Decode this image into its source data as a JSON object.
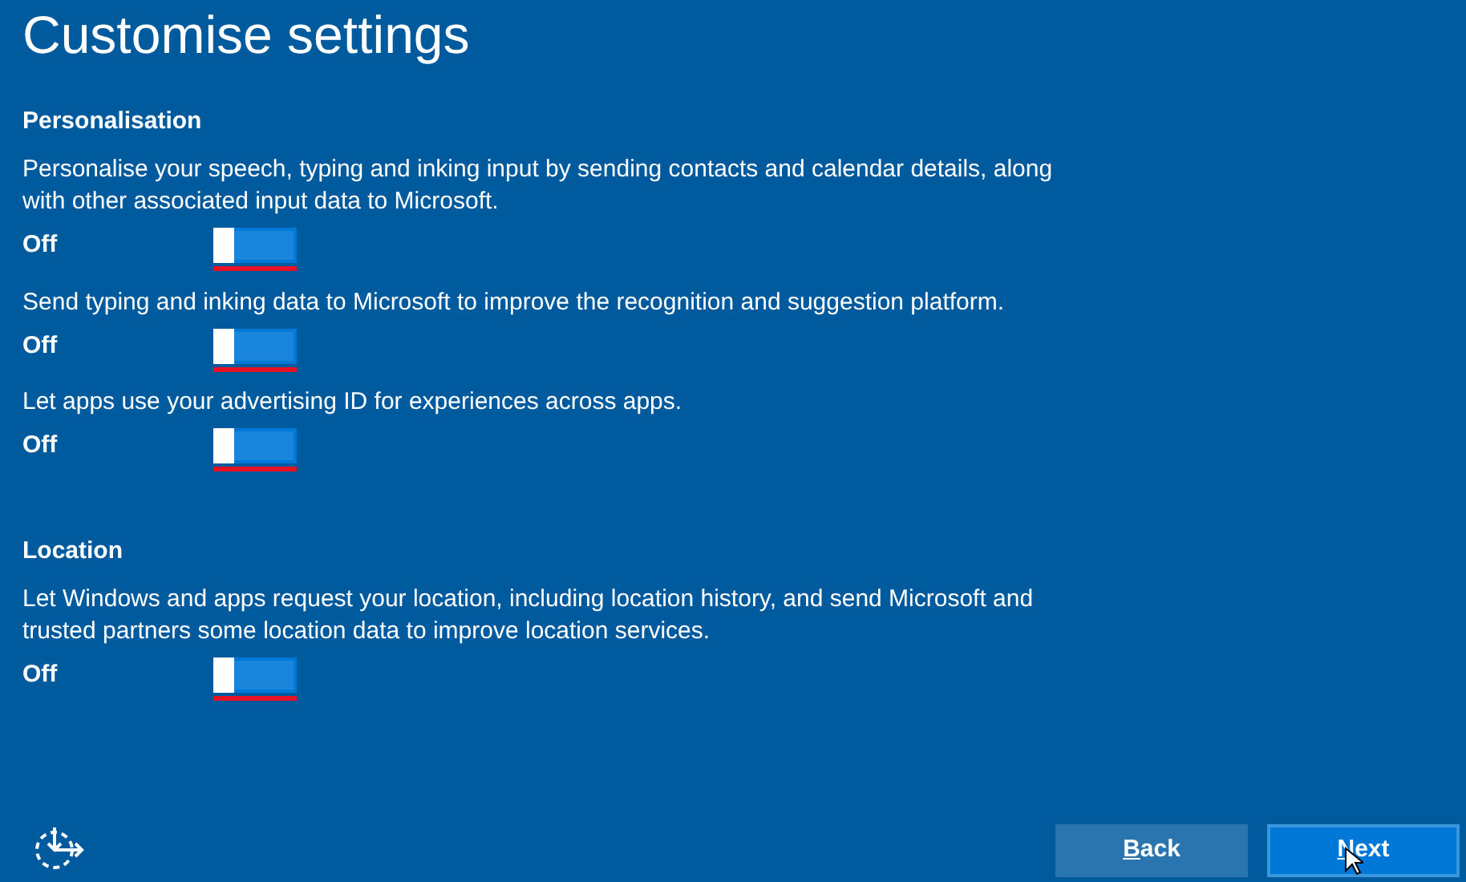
{
  "title": "Customise settings",
  "sections": [
    {
      "heading": "Personalisation",
      "settings": [
        {
          "description": "Personalise your speech, typing and inking input by sending contacts and calendar details, along with other associated input data to Microsoft.",
          "state_label": "Off",
          "on": false,
          "underlined": true
        },
        {
          "description": "Send typing and inking data to Microsoft to improve the recognition and suggestion platform.",
          "state_label": "Off",
          "on": false,
          "underlined": true
        },
        {
          "description": "Let apps use your advertising ID for experiences across apps.",
          "state_label": "Off",
          "on": false,
          "underlined": true
        }
      ]
    },
    {
      "heading": "Location",
      "settings": [
        {
          "description": "Let Windows and apps request your location, including location history, and send Microsoft and trusted partners some location data to improve location services.",
          "state_label": "Off",
          "on": false,
          "underlined": true
        }
      ]
    }
  ],
  "buttons": [
    {
      "label": "Back",
      "kind": "secondary"
    },
    {
      "label": "Next",
      "kind": "primary"
    }
  ]
}
